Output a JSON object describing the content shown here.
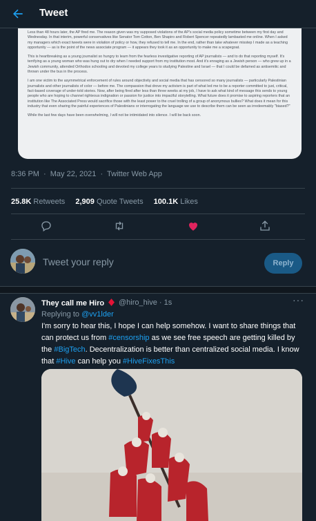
{
  "header": {
    "title": "Tweet",
    "back_icon": "arrow-left-icon"
  },
  "embed": {
    "paragraphs": [
      "Less than 48 hours later, the AP fired me. The reason given was my supposed violations of the AP's social media policy sometime between my first day and Wednesday. In that interim, powerful conservatives like Senator Tom Cotton, Ben Shapiro and Robert Spencer repeatedly lambasted me online. When I asked my managers which exact tweets were in violation of policy or how, they refused to tell me. In the end, rather than take whatever misstep I made as a teaching opportunity — as is the point of the news associate program — it appears they took it as an opportunity to make me a scapegoat.",
      "This is heartbreaking as a young journalist so hungry to learn from the fearless investigative reporting of AP journalists — and to do that reporting myself. It's terrifying as a young woman who was hung out to dry when I needed support from my institution most. And it's enraging as a Jewish person — who grew up in a Jewish community, attended Orthodox schooling and devoted my college years to studying Palestine and Israel — that I could be defamed as antisemitic and thrown under the bus in the process.",
      "I am one victim to the asymmetrical enforcement of rules around objectivity and social media that has censored so many journalists — particularly Palestinian journalists and other journalists of color — before me. The compassion that drove my activism is part of what led me to be a reporter committed to just, critical, fact-based coverage of under-told stories. Now, after being fired after less than three weeks at my job, I have to ask what kind of message this sends to young people who are hoping to channel righteous indignation or passion for justice into impactful storytelling. What future does it promise to aspiring reporters that an institution like The Associated Press would sacrifice those with the least power to the cruel trolling of a group of anonymous bullies? What does it mean for this industry that even sharing the painful experiences of Palestinians or interrogating the language we use to describe them can be seen as irredeemably \"biased?\"",
      "While the last few days have been overwhelming, I will not be intimidated into silence. I will be back soon."
    ]
  },
  "meta": {
    "time": "8:36 PM",
    "dot": "·",
    "date": "May 22, 2021",
    "source": "Twitter Web App"
  },
  "stats": {
    "retweets_count": "25.8K",
    "retweets_label": "Retweets",
    "quotes_count": "2,909",
    "quotes_label": "Quote Tweets",
    "likes_count": "100.1K",
    "likes_label": "Likes"
  },
  "actions": [
    "reply-icon",
    "retweet-icon",
    "heart-icon",
    "share-icon"
  ],
  "reply_box": {
    "placeholder": "Tweet your reply",
    "button": "Reply"
  },
  "reply_tweet": {
    "name": "They call me Hiro",
    "handle": "@hiro_hive",
    "dot": "·",
    "time": "1s",
    "more": "···",
    "replying_prefix": "Replying to",
    "replying_to": "@vv1lder",
    "body": {
      "t1": "I'm sorry to hear this, I hope I can help somehow. I want to share things that can protect us from ",
      "tag1": "#censorship",
      "t2": " as we see free speech are getting killed by the ",
      "tag2": "#BigTech",
      "t3": ". Decentralization is better than centralized social media. I know that ",
      "tag3": "#Hive",
      "t4": " can help you ",
      "tag4": "#HiveFixesThis"
    }
  },
  "colors": {
    "background": "#15202b",
    "accent": "#1da1f2",
    "like": "#e0245e",
    "muted": "#8899a6",
    "border": "#38444d"
  }
}
